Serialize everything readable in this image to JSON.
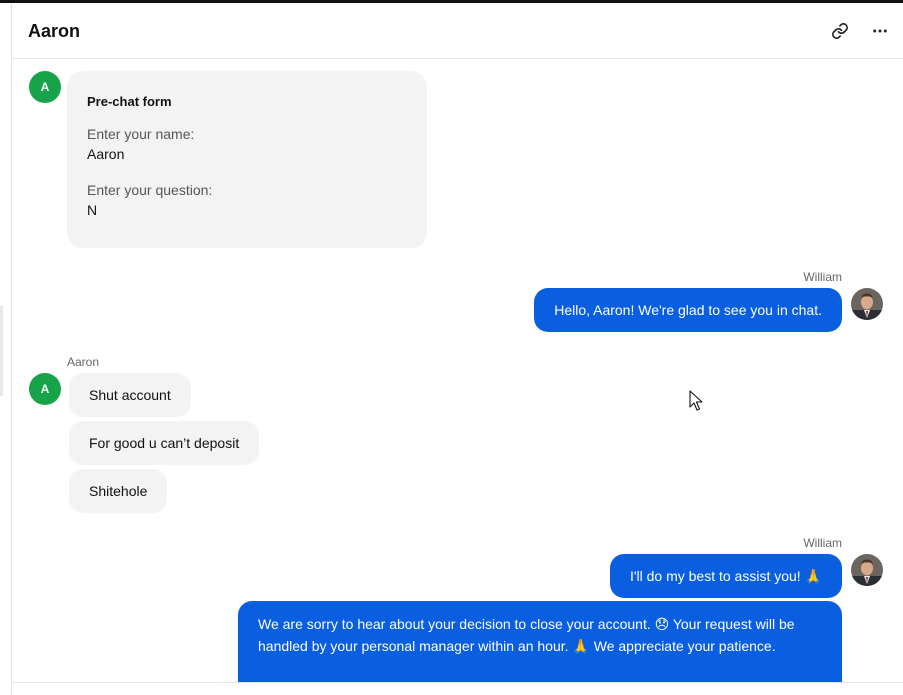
{
  "header": {
    "title": "Aaron",
    "link_icon": "link-icon",
    "more_icon": "more-horizontal-icon"
  },
  "customer": {
    "initial": "A",
    "name": "Aaron",
    "avatar_color": "#16a34a"
  },
  "agent": {
    "name": "William",
    "bubble_color": "#0a5ee0"
  },
  "prechat": {
    "title": "Pre-chat form",
    "fields": [
      {
        "label": "Enter your name:",
        "value": "Aaron"
      },
      {
        "label": "Enter your question:",
        "value": "N"
      }
    ]
  },
  "messages": {
    "agent_greeting": "Hello, Aaron! We're glad to see you in chat.",
    "customer_1": "Shut account",
    "customer_2": "For good u can’t deposit",
    "customer_3": "Shitehole",
    "agent_reply_1": "I'll do my best to assist you! 🙏",
    "agent_reply_2": "We are sorry to hear about your decision to close your account. 😞 Your request will be handled by your personal manager within an hour. 🙏 We appreciate your patience."
  }
}
